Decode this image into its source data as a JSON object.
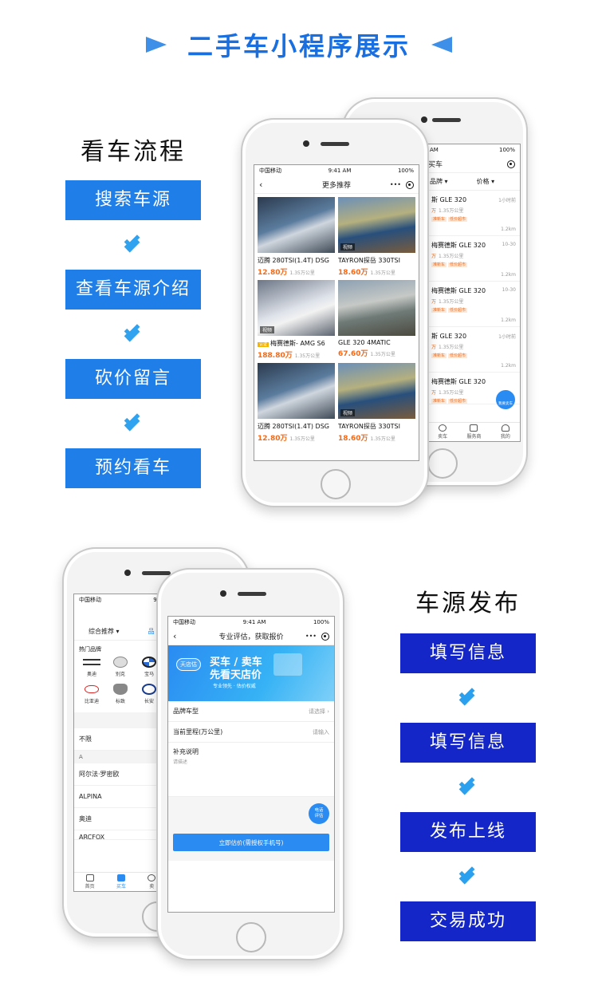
{
  "page_title": "二手车小程序展示",
  "viewing_flow": {
    "heading": "看车流程",
    "steps": [
      "搜索车源",
      "查看车源介绍",
      "砍价留言",
      "预约看车"
    ]
  },
  "publish_flow": {
    "heading": "车源发布",
    "steps": [
      "填写信息",
      "填写信息",
      "发布上线",
      "交易成功"
    ]
  },
  "colors": {
    "accent": "#1a6fe0",
    "flow_a_step": "#1f7ee8",
    "flow_b_step": "#1426c8",
    "price": "#f26b1d",
    "app_blue": "#2a8bf2"
  },
  "status_bar": {
    "carrier": "中国移动",
    "time": "9:41 AM",
    "battery": "100%"
  },
  "phone_recommend": {
    "nav_title": "更多推荐",
    "cards": [
      {
        "name": "迈腾 280TSI(1.4T) DSG",
        "price": "12.80万",
        "mileage": "1.35万公里",
        "tag": ""
      },
      {
        "name": "TAYRON探岳 330TSI",
        "price": "18.60万",
        "mileage": "1.35万公里",
        "tag": "视频"
      },
      {
        "name": "梅赛德斯- AMG S6",
        "price": "188.80万",
        "mileage": "1.35万公里",
        "tag": "视频",
        "badge": "认证"
      },
      {
        "name": "GLE 320 4MATIC",
        "price": "67.60万",
        "mileage": "1.35万公里",
        "tag": ""
      },
      {
        "name": "迈腾 280TSI(1.4T) DSG",
        "price": "12.80万",
        "mileage": "1.35万公里",
        "tag": ""
      },
      {
        "name": "TAYRON探岳 330TSI",
        "price": "18.60万",
        "mileage": "1.35万公里",
        "tag": "视频"
      }
    ]
  },
  "phone_buy": {
    "nav_title": "买车",
    "filters": [
      "品牌",
      "价格"
    ],
    "rows": [
      {
        "title": "斯 GLE 320",
        "time": "1小时前",
        "price": "万",
        "mileage": "1.35万公里",
        "badges": [
          "准新车",
          "低价超市"
        ],
        "dist": "1.2km"
      },
      {
        "title": "梅赛德斯 GLE 320",
        "time": "10-30",
        "price": "万",
        "mileage": "1.35万公里",
        "badges": [
          "准新车",
          "低价超市"
        ],
        "dist": "1.2km"
      },
      {
        "title": "梅赛德斯 GLE 320",
        "time": "10-30",
        "price": "万",
        "mileage": "1.35万公里",
        "badges": [
          "准新车",
          "低价超市"
        ],
        "dist": "1.2km"
      },
      {
        "title": "斯 GLE 320",
        "time": "1小时前",
        "price": "万",
        "mileage": "1.35万公里",
        "badges": [
          "准新车",
          "低价超市"
        ],
        "dist": "1.2km"
      },
      {
        "title": "梅赛德斯 GLE 320",
        "time": "",
        "price": "万",
        "mileage": "1.35万公里",
        "badges": [
          "准新车",
          "低价超市"
        ],
        "dist": ""
      }
    ],
    "fab": "我要卖车",
    "tabs": [
      "卖车",
      "服务商",
      "我的"
    ]
  },
  "phone_brands": {
    "nav_title": "买",
    "filters": [
      "综合推荐",
      "品"
    ],
    "hot_label": "热门品牌",
    "brands": [
      "奥迪",
      "别克",
      "宝马",
      "比亚迪",
      "标致",
      "长安"
    ],
    "index_rows": [
      "不限"
    ],
    "index_head": "A",
    "index_rows_2": [
      "阿尔法·罗密欧",
      "ALPINA",
      "奥迪",
      "ARCFOX"
    ],
    "collapse": "收",
    "tabs": [
      "首页",
      "买车",
      "卖"
    ]
  },
  "phone_valuation": {
    "nav_title": "专业评估，获取报价",
    "banner_logo": "天店估",
    "banner_line1": "买车 / 卖车",
    "banner_line2": "先看天店价",
    "banner_line3": "专业领先 · 估价权威",
    "field_brand": "品牌车型",
    "field_brand_hint": "请选择",
    "field_mileage": "当前里程(万公里)",
    "field_mileage_hint": "请输入",
    "note_label": "补充说明",
    "note_placeholder": "请描述",
    "phone_bubble": "电话评估",
    "submit": "立即估价(需授权手机号)"
  }
}
